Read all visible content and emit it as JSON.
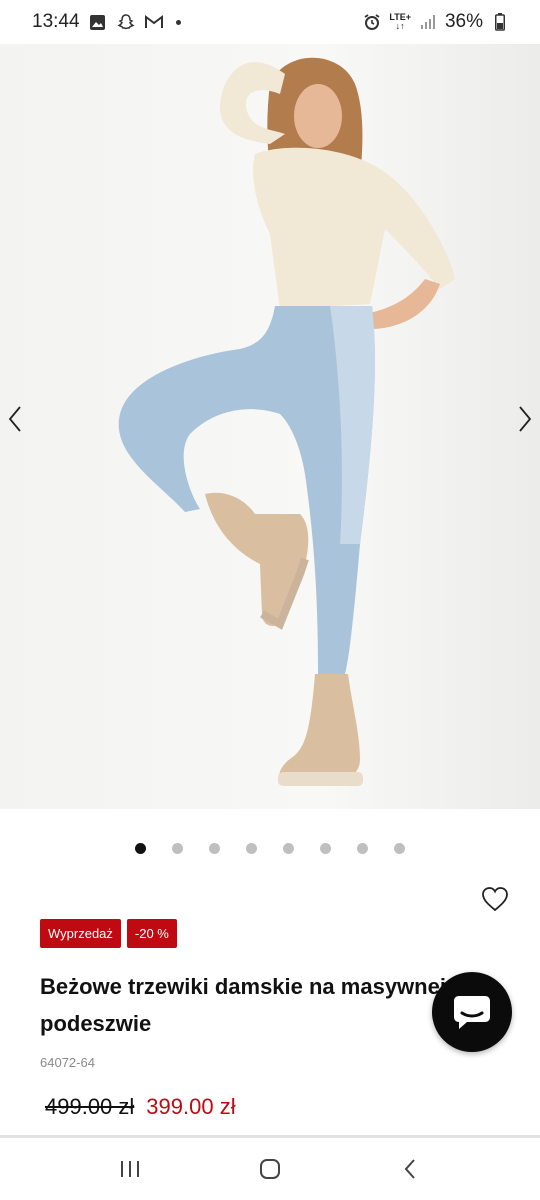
{
  "status_bar": {
    "time": "13:44",
    "network": "LTE+",
    "battery": "36%",
    "icons": [
      "image-icon",
      "snapchat-icon",
      "gmail-icon",
      "dot-icon",
      "alarm-icon",
      "lte-icon",
      "signal-icon",
      "battery-icon"
    ]
  },
  "gallery": {
    "image": "product-photo",
    "prev_icon": "chevron-left-icon",
    "next_icon": "chevron-right-icon",
    "slide_count": 8,
    "active_slide": 1
  },
  "wishlist_icon": "heart-outline-icon",
  "badges": {
    "sale": "Wyprzedaż",
    "discount": "-20 %"
  },
  "product": {
    "title": "Beżowe trzewiki damskie na masywnej podeszwie",
    "sku": "64072-64",
    "old_price": "499.00 zł",
    "new_price": "399.00 zł"
  },
  "chat_icon": "chat-bubble-icon",
  "colors": {
    "accent_red": "#c00a12",
    "fab_black": "#0b0b0b"
  },
  "android_nav": {
    "icons": [
      "recent-apps-icon",
      "home-icon",
      "back-icon"
    ]
  }
}
